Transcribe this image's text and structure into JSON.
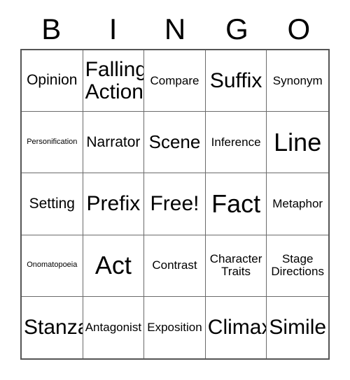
{
  "card": {
    "title": "BINGO",
    "header_letters": [
      "B",
      "I",
      "N",
      "G",
      "O"
    ],
    "rows": [
      [
        {
          "label": "Opinion",
          "size": "s-lg"
        },
        {
          "label": "Falling\nAction",
          "size": "s-xxl"
        },
        {
          "label": "Compare",
          "size": "s-md"
        },
        {
          "label": "Suffix",
          "size": "s-xxl"
        },
        {
          "label": "Synonym",
          "size": "s-md"
        }
      ],
      [
        {
          "label": "Personification",
          "size": "s-xs"
        },
        {
          "label": "Narrator",
          "size": "s-lg"
        },
        {
          "label": "Scene",
          "size": "s-xl"
        },
        {
          "label": "Inference",
          "size": "s-md"
        },
        {
          "label": "Line",
          "size": "s-huge"
        }
      ],
      [
        {
          "label": "Setting",
          "size": "s-lg"
        },
        {
          "label": "Prefix",
          "size": "s-xxl"
        },
        {
          "label": "Free!",
          "size": "s-xxl"
        },
        {
          "label": "Fact",
          "size": "s-huge"
        },
        {
          "label": "Metaphor",
          "size": "s-md"
        }
      ],
      [
        {
          "label": "Onomatopoeia",
          "size": "s-xs"
        },
        {
          "label": "Act",
          "size": "s-huge"
        },
        {
          "label": "Contrast",
          "size": "s-md"
        },
        {
          "label": "Character\nTraits",
          "size": "s-md"
        },
        {
          "label": "Stage\nDirections",
          "size": "s-md"
        }
      ],
      [
        {
          "label": "Stanza",
          "size": "s-xxl"
        },
        {
          "label": "Antagonist",
          "size": "s-md"
        },
        {
          "label": "Exposition",
          "size": "s-md"
        },
        {
          "label": "Climax",
          "size": "s-xxl"
        },
        {
          "label": "Simile",
          "size": "s-xxl"
        }
      ]
    ],
    "free_space": {
      "row": 2,
      "col": 2,
      "label": "Free!"
    },
    "colors": {
      "text": "#000000",
      "background": "#ffffff",
      "grid_line": "#6b6b6b",
      "grid_border": "#555555"
    }
  }
}
